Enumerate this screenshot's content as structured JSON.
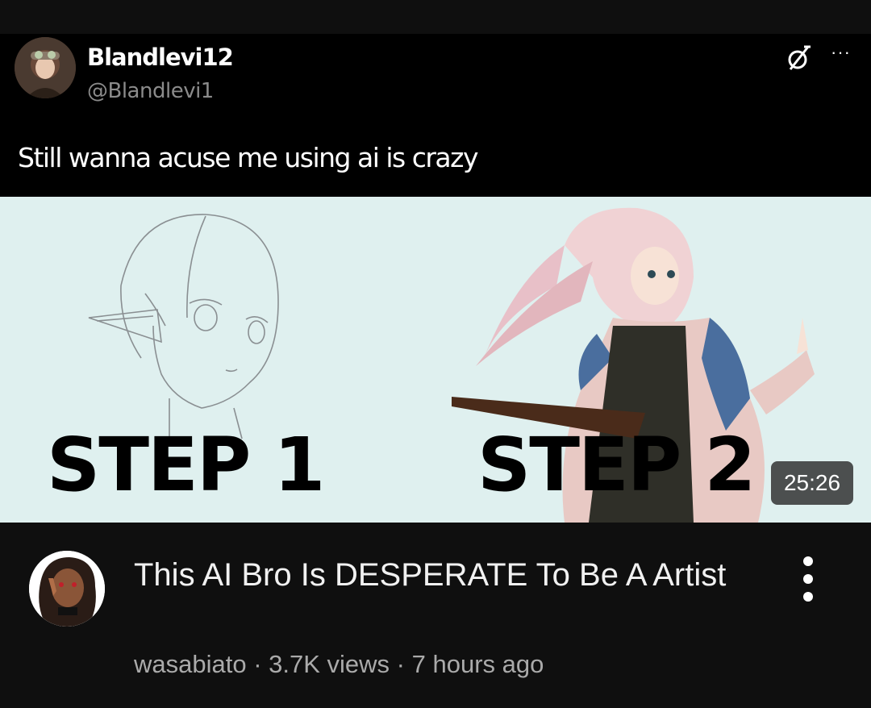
{
  "tweet": {
    "display_name": "Blandlevi12",
    "handle": "@Blandlevi1",
    "text": "Still wanna acuse me using ai is crazy"
  },
  "thumbnail": {
    "step1_label": "STEP 1",
    "step2_label": "STEP 2",
    "duration": "25:26"
  },
  "video": {
    "title": "This AI Bro Is DESPERATE To Be A Artist",
    "channel": "wasabiato",
    "views": "3.7K views",
    "age": "7 hours ago",
    "separator": " · "
  },
  "icons": [
    "x-platform-icon",
    "more-horizontal-icon",
    "more-vertical-icon"
  ],
  "colors": {
    "background": "#0f0f0f",
    "step_red": "#e8232b",
    "meta_gray": "#aaaaaa"
  }
}
